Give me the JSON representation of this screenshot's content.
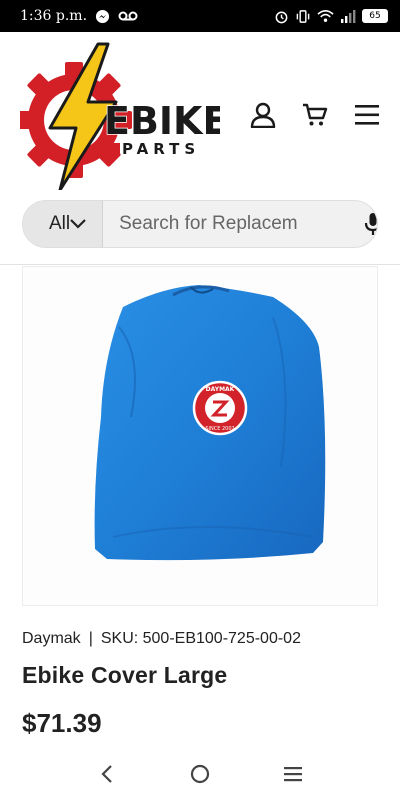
{
  "status_bar": {
    "time": "1:36 p.m.",
    "battery": "65",
    "icons": [
      "messenger-icon",
      "voicemail-icon",
      "alarm-icon",
      "vibrate-icon",
      "wifi-icon",
      "signal-icon",
      "battery-icon"
    ]
  },
  "header": {
    "logo": {
      "word_main": "EBIKE",
      "word_sub": "PARTS",
      "colors": {
        "gear": "#d32027",
        "bolt": "#f5c518",
        "text": "#1a1a1a"
      }
    },
    "icons": [
      "account-icon",
      "cart-icon",
      "menu-icon"
    ]
  },
  "search": {
    "category_value": "All",
    "placeholder": "Search for Replacem"
  },
  "product": {
    "brand": "Daymak",
    "separator": "|",
    "sku": "SKU: 500-EB100-725-00-02",
    "title": "Ebike Cover Large",
    "price": "$71.39",
    "image": {
      "badge_top": "DAYMAK",
      "badge_bottom": "SINCE 2002",
      "colors": {
        "bag": "#1f7fd6",
        "badge": "#d2232a"
      }
    }
  },
  "nav_bar": {
    "icons": [
      "back-icon",
      "home-icon",
      "recents-icon"
    ]
  }
}
